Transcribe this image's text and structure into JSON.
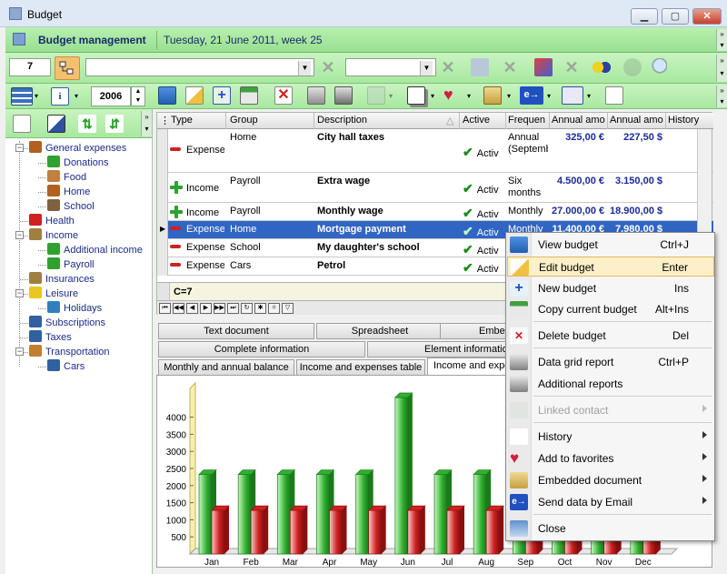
{
  "window": {
    "title": "Budget",
    "min": "▁",
    "max": "▢",
    "close": "✕"
  },
  "header": {
    "title": "Budget management",
    "date": "Tuesday, 21 June 2011, week 25"
  },
  "toolbar1": {
    "count": "7",
    "search_value": "",
    "filter_value": ""
  },
  "toolbar2": {
    "year": "2006"
  },
  "tree": [
    {
      "label": "General expenses",
      "level": 0,
      "icon": "house-icon",
      "color": "#b06020"
    },
    {
      "label": "Donations",
      "level": 1,
      "icon": "money-icon",
      "color": "#30a030"
    },
    {
      "label": "Food",
      "level": 1,
      "icon": "food-icon",
      "color": "#c08040"
    },
    {
      "label": "Home",
      "level": 1,
      "icon": "house-icon",
      "color": "#b06020"
    },
    {
      "label": "School",
      "level": 1,
      "icon": "school-icon",
      "color": "#806040"
    },
    {
      "label": "Health",
      "level": 0,
      "icon": "heart-icon",
      "color": "#d02020"
    },
    {
      "label": "Income",
      "level": 0,
      "icon": "moneybag-icon",
      "color": "#a08040"
    },
    {
      "label": "Additional income",
      "level": 1,
      "icon": "money-icon",
      "color": "#30a030"
    },
    {
      "label": "Payroll",
      "level": 1,
      "icon": "dollar-icon",
      "color": "#30a030"
    },
    {
      "label": "Insurances",
      "level": 0,
      "icon": "lock-icon",
      "color": "#a08040"
    },
    {
      "label": "Leisure",
      "level": 0,
      "icon": "smiley-icon",
      "color": "#e8c820"
    },
    {
      "label": "Holidays",
      "level": 1,
      "icon": "beach-icon",
      "color": "#3080c0"
    },
    {
      "label": "Subscriptions",
      "level": 0,
      "icon": "book-icon",
      "color": "#3060a0"
    },
    {
      "label": "Taxes",
      "level": 0,
      "icon": "document-icon",
      "color": "#3060a0"
    },
    {
      "label": "Transportation",
      "level": 0,
      "icon": "truck-icon",
      "color": "#c08030"
    },
    {
      "label": "Cars",
      "level": 1,
      "icon": "car-icon",
      "color": "#3060a0"
    }
  ],
  "grid": {
    "columns": [
      "Type",
      "Group",
      "Description",
      "Active",
      "Frequen",
      "Annual amo",
      "Annual amo",
      "History"
    ],
    "rows": [
      {
        "type": "Expense",
        "sign": "minus",
        "group": "Home",
        "description": "City hall taxes",
        "active": "Activ",
        "frequency": "Annual (September)",
        "amount_eur": "325,00 €",
        "amount_usd": "227,50 $",
        "selected": false
      },
      {
        "type": "Income",
        "sign": "plus",
        "group": "Payroll",
        "description": "Extra wage",
        "active": "Activ",
        "frequency": "Six months",
        "amount_eur": "4.500,00 €",
        "amount_usd": "3.150,00 $",
        "selected": false
      },
      {
        "type": "Income",
        "sign": "plus",
        "group": "Payroll",
        "description": "Monthly wage",
        "active": "Activ",
        "frequency": "Monthly",
        "amount_eur": "27.000,00 €",
        "amount_usd": "18.900,00 $",
        "selected": false
      },
      {
        "type": "Expense",
        "sign": "minus",
        "group": "Home",
        "description": "Mortgage payment",
        "active": "Activ",
        "frequency": "Monthly",
        "amount_eur": "11.400,00 €",
        "amount_usd": "7.980,00 $",
        "selected": true
      },
      {
        "type": "Expense",
        "sign": "minus",
        "group": "School",
        "description": "My daughter's school",
        "active": "Activ",
        "frequency": "",
        "amount_eur": "",
        "amount_usd": "",
        "selected": false
      },
      {
        "type": "Expense",
        "sign": "minus",
        "group": "Cars",
        "description": "Petrol",
        "active": "Activ",
        "frequency": "",
        "amount_eur": "",
        "amount_usd": "",
        "selected": false
      }
    ],
    "footer": "C=7"
  },
  "tabs": {
    "row1": [
      "Text document",
      "Spreadsheet",
      "Embe"
    ],
    "row2": [
      "Complete information",
      "Element information"
    ],
    "row3": [
      "Monthly and annual balance",
      "Income and expenses table",
      "Income and expe"
    ]
  },
  "chart_data": {
    "type": "bar",
    "categories": [
      "Jan",
      "Feb",
      "Mar",
      "Apr",
      "May",
      "Jun",
      "Jul",
      "Aug",
      "Sep",
      "Oct",
      "Nov",
      "Dec"
    ],
    "series": [
      {
        "values": [
          2325,
          2325,
          2325,
          2325,
          2325,
          4575,
          2325,
          2325,
          2325,
          2325,
          2325,
          2325
        ],
        "color": "#30b030"
      },
      {
        "values": [
          1275,
          1275,
          1275,
          1275,
          1275,
          1275,
          1275,
          1275,
          1275,
          1275,
          1275,
          1275
        ],
        "color": "#d02020"
      }
    ],
    "yticks": [
      500,
      1000,
      1500,
      2000,
      2500,
      3000,
      3500,
      4000
    ],
    "ylim": [
      0,
      5000
    ]
  },
  "context_menu": {
    "items": [
      {
        "label": "View budget",
        "shortcut": "Ctrl+J",
        "icon": "monitor-icon",
        "highlighted": false,
        "disabled": false,
        "submenu": false
      },
      {
        "label": "Edit budget",
        "shortcut": "Enter",
        "icon": "edit-icon",
        "highlighted": true,
        "disabled": false,
        "submenu": false
      },
      {
        "label": "New budget",
        "shortcut": "Ins",
        "icon": "new-icon",
        "highlighted": false,
        "disabled": false,
        "submenu": false
      },
      {
        "label": "Copy current budget",
        "shortcut": "Alt+Ins",
        "icon": "copy-icon",
        "highlighted": false,
        "disabled": false,
        "submenu": false
      },
      {
        "label": "Delete budget",
        "shortcut": "Del",
        "icon": "delete-icon",
        "highlighted": false,
        "disabled": false,
        "submenu": false
      },
      {
        "label": "Data grid report",
        "shortcut": "Ctrl+P",
        "icon": "printer-icon",
        "highlighted": false,
        "disabled": false,
        "submenu": false
      },
      {
        "label": "Additional reports",
        "shortcut": "",
        "icon": "printer-icon",
        "highlighted": false,
        "disabled": false,
        "submenu": false
      },
      {
        "label": "Linked contact",
        "shortcut": "",
        "icon": "contact-icon",
        "highlighted": false,
        "disabled": true,
        "submenu": true
      },
      {
        "label": "History",
        "shortcut": "",
        "icon": "history-icon",
        "highlighted": false,
        "disabled": false,
        "submenu": true
      },
      {
        "label": "Add to favorites",
        "shortcut": "",
        "icon": "favorite-icon",
        "highlighted": false,
        "disabled": false,
        "submenu": true
      },
      {
        "label": "Embedded document",
        "shortcut": "",
        "icon": "folder-icon",
        "highlighted": false,
        "disabled": false,
        "submenu": true
      },
      {
        "label": "Send data by Email",
        "shortcut": "",
        "icon": "email-icon",
        "highlighted": false,
        "disabled": false,
        "submenu": true
      },
      {
        "label": "Close",
        "shortcut": "",
        "icon": "close-window-icon",
        "highlighted": false,
        "disabled": false,
        "submenu": false
      }
    ]
  }
}
